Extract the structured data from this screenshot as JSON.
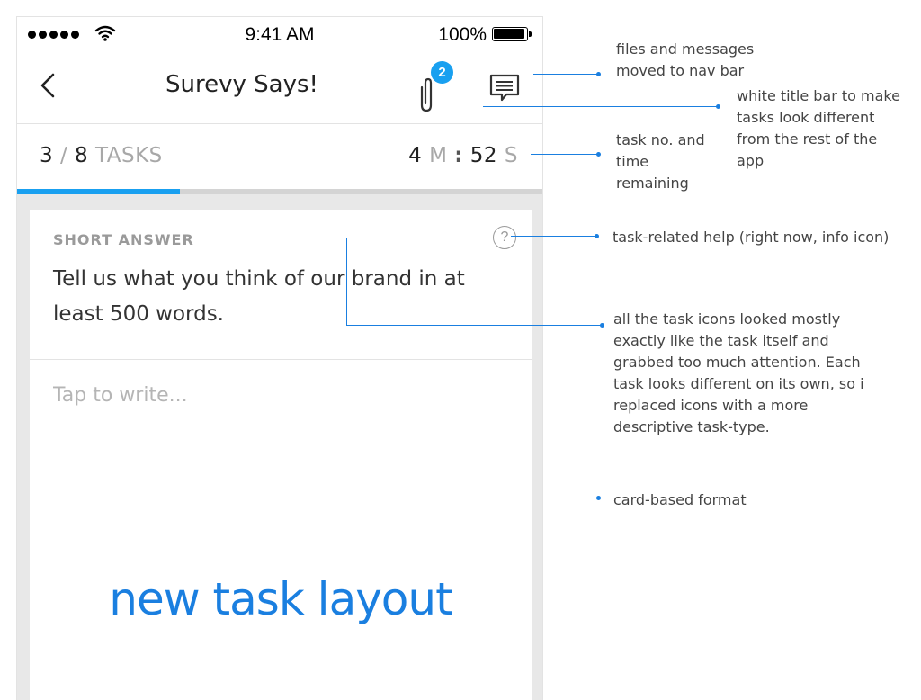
{
  "status_bar": {
    "time": "9:41 AM",
    "battery": "100%"
  },
  "nav_bar": {
    "title": "Surevy Says!",
    "attachment_badge": "2"
  },
  "task_bar": {
    "current": "3",
    "separator": "/",
    "total": "8",
    "unit": "TASKS",
    "minutes": "4",
    "minutes_unit": "M",
    "time_separator": ":",
    "seconds": "52",
    "seconds_unit": "S",
    "progress_fraction": 0.31
  },
  "card": {
    "task_type": "SHORT ANSWER",
    "help_symbol": "?",
    "prompt": "Tell us what you think of our brand in at least 500 words.",
    "input_placeholder": "Tap to write...",
    "caption": "new task layout"
  },
  "annotations": {
    "nav_files": [
      "files and messages",
      "moved to nav bar"
    ],
    "title_bar": [
      "white title bar to make",
      "tasks look different",
      "from the rest of the",
      "app"
    ],
    "task_timer": [
      "task no. and",
      "time",
      "remaining"
    ],
    "help": [
      "task-related help (right now, info icon)"
    ],
    "task_icons": [
      "all the task icons looked mostly",
      "exactly like the task itself and",
      "grabbed too much attention. Each",
      "task looks different on its own, so i",
      "replaced icons with a more",
      "descriptive task-type."
    ],
    "card_format": [
      "card-based format"
    ]
  },
  "colors": {
    "accent": "#19a0f0",
    "annotation_line": "#1a7fe0",
    "muted_text": "#a8a8a8"
  },
  "icons": {
    "back": "chevron-left-icon",
    "attachment": "paperclip-icon",
    "messages": "message-icon",
    "help": "question-circle-icon",
    "wifi": "wifi-icon",
    "battery": "battery-icon"
  }
}
